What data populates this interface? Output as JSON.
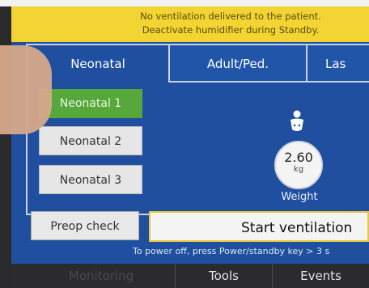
{
  "banner": {
    "line1": "No ventilation delivered to the patient.",
    "line2": "Deactivate humidifier during Standby."
  },
  "tabs": [
    {
      "label": "Neonatal",
      "active": true
    },
    {
      "label": "Adult/Ped.",
      "active": false
    },
    {
      "label": "Las",
      "active": false
    }
  ],
  "subtypes": [
    {
      "label": "Neonatal 1",
      "selected": true
    },
    {
      "label": "Neonatal 2",
      "selected": false
    },
    {
      "label": "Neonatal 3",
      "selected": false
    }
  ],
  "weight": {
    "value": "2.60",
    "unit": "kg",
    "label": "Weight"
  },
  "actions": {
    "preop": "Preop check",
    "start": "Start ventilation"
  },
  "hint": "To power off,  press Power/standby key > 3 s",
  "bottom_nav": [
    {
      "label": "Monitoring"
    },
    {
      "label": "Tools"
    },
    {
      "label": "Events"
    }
  ],
  "colors": {
    "screen_bg": "#1f4f9e",
    "banner_bg": "#f2d533",
    "selected_green": "#57a83b",
    "start_border": "#e6c93a"
  }
}
